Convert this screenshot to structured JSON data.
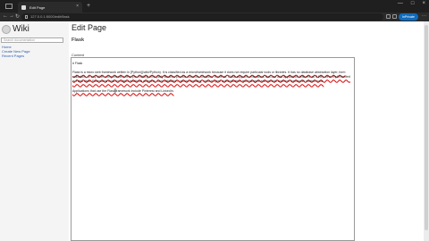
{
  "browser": {
    "tab_title": "Edit Page",
    "close_glyph": "×",
    "new_tab_glyph": "+",
    "address": "127.0.0.1:5000/edit/flask",
    "profile_label": "InPrivate",
    "window_controls": [
      "—",
      "□",
      "×"
    ],
    "nav": {
      "back": "←",
      "forward": "→",
      "refresh": "↻"
    },
    "menu_glyph": "···"
  },
  "sidebar": {
    "logo_text": "Wiki",
    "search_placeholder": "Search documentation",
    "links": [
      "Home",
      "Create New Page",
      "Recent Pages"
    ]
  },
  "main": {
    "title": "Edit Page",
    "page_name": "Flask",
    "content_label": "Content",
    "content_heading": "# Flask",
    "content_paragraphs": [
      "Flask is a micro web framework written in [Python](/wiki/Python). It is classified as a microframework because it does not require particular tools or libraries. It has no database abstraction layer, form validation, or any other components where pre-existing third-party libraries provide common functions. However, Flask supports extensions that can add application features as if they were implemented in Flask itself. Extensions exist for object-relational mappers, form validation, upload handling, various open authentication technologies and several common framework related tools.",
      "Applications that use the Flask framework include Pinterest and LinkedIn."
    ]
  },
  "icons": {
    "lock": "lock-icon",
    "star": "star-icon",
    "extensions": "extensions-icon",
    "cursor": "I-beam-cursor"
  }
}
